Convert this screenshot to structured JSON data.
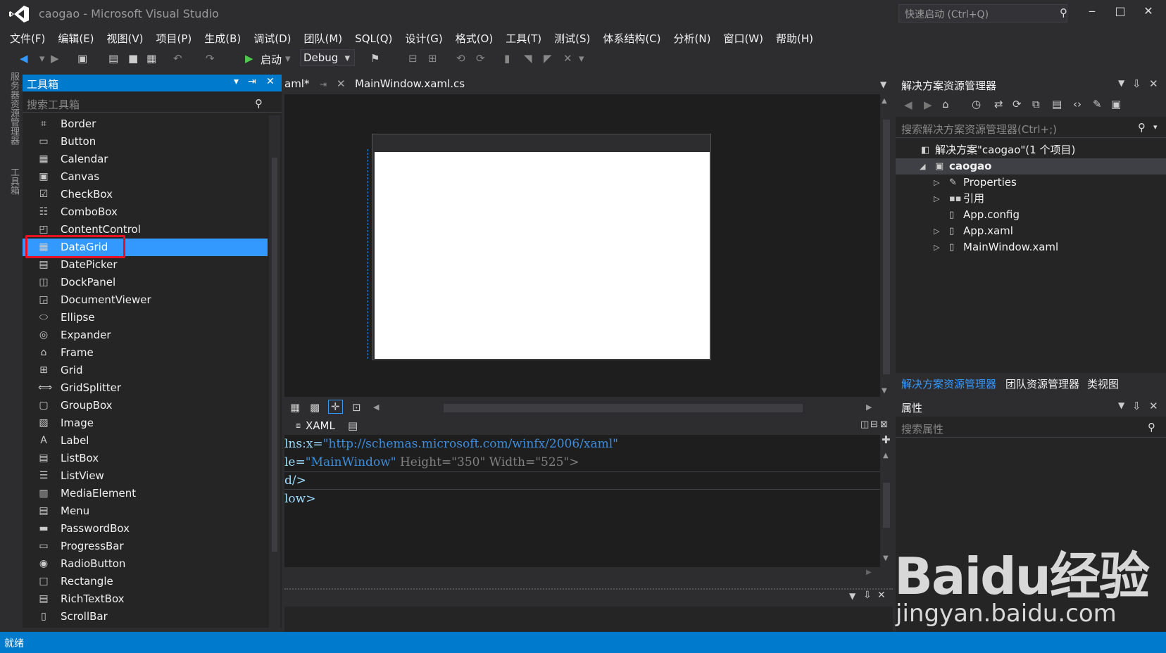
{
  "app": {
    "title": "caogao - Microsoft Visual Studio",
    "quick_launch": "快速启动 (Ctrl+Q)"
  },
  "window_controls": {
    "minimize": "‒",
    "maximize": "□",
    "close": "✕"
  },
  "menu": [
    "文件(F)",
    "编辑(E)",
    "视图(V)",
    "项目(P)",
    "生成(B)",
    "调试(D)",
    "团队(M)",
    "SQL(Q)",
    "设计(G)",
    "格式(O)",
    "工具(T)",
    "测试(S)",
    "体系结构(C)",
    "分析(N)",
    "窗口(W)",
    "帮助(H)"
  ],
  "toolbar": {
    "start_label": "启动",
    "config": "Debug"
  },
  "left_strip": {
    "server_explorer": "服务器资源管理器",
    "toolbox": "工具箱"
  },
  "toolbox": {
    "title": "工具箱",
    "search_placeholder": "搜索工具箱",
    "items": [
      {
        "label": "Border",
        "icon": "border-icon"
      },
      {
        "label": "Button",
        "icon": "button-icon"
      },
      {
        "label": "Calendar",
        "icon": "calendar-icon"
      },
      {
        "label": "Canvas",
        "icon": "canvas-icon"
      },
      {
        "label": "CheckBox",
        "icon": "checkbox-icon"
      },
      {
        "label": "ComboBox",
        "icon": "combobox-icon"
      },
      {
        "label": "ContentControl",
        "icon": "contentcontrol-icon"
      },
      {
        "label": "DataGrid",
        "icon": "datagrid-icon",
        "selected": true
      },
      {
        "label": "DatePicker",
        "icon": "datepicker-icon"
      },
      {
        "label": "DockPanel",
        "icon": "dockpanel-icon"
      },
      {
        "label": "DocumentViewer",
        "icon": "documentviewer-icon"
      },
      {
        "label": "Ellipse",
        "icon": "ellipse-icon"
      },
      {
        "label": "Expander",
        "icon": "expander-icon"
      },
      {
        "label": "Frame",
        "icon": "frame-icon"
      },
      {
        "label": "Grid",
        "icon": "grid-icon"
      },
      {
        "label": "GridSplitter",
        "icon": "gridsplitter-icon"
      },
      {
        "label": "GroupBox",
        "icon": "groupbox-icon"
      },
      {
        "label": "Image",
        "icon": "image-icon"
      },
      {
        "label": "Label",
        "icon": "label-icon"
      },
      {
        "label": "ListBox",
        "icon": "listbox-icon"
      },
      {
        "label": "ListView",
        "icon": "listview-icon"
      },
      {
        "label": "MediaElement",
        "icon": "mediaelement-icon"
      },
      {
        "label": "Menu",
        "icon": "menu-icon"
      },
      {
        "label": "PasswordBox",
        "icon": "passwordbox-icon"
      },
      {
        "label": "ProgressBar",
        "icon": "progressbar-icon"
      },
      {
        "label": "RadioButton",
        "icon": "radiobutton-icon"
      },
      {
        "label": "Rectangle",
        "icon": "rectangle-icon"
      },
      {
        "label": "RichTextBox",
        "icon": "richtextbox-icon"
      },
      {
        "label": "ScrollBar",
        "icon": "scrollbar-icon"
      }
    ]
  },
  "tabs": {
    "tab1": "aml*",
    "tab2": "MainWindow.xaml.cs"
  },
  "xaml": {
    "tab_label": "XAML",
    "lines": [
      {
        "a": "lns:x=",
        "v": "\"http://schemas.microsoft.com/winfx/2006/xaml\"",
        "b": ""
      },
      {
        "a": "le=",
        "v": "\"MainWindow\"",
        "b": " Height=\"350\" Width=\"525\">"
      },
      {
        "a": "d/>",
        "v": "",
        "b": ""
      },
      {
        "a": "low>",
        "v": "",
        "b": ""
      }
    ]
  },
  "solution_explorer": {
    "title": "解决方案资源管理器",
    "search_placeholder": "搜索解决方案资源管理器(Ctrl+;)",
    "tree": [
      {
        "label": "解决方案\"caogao\"(1 个项目)",
        "icon": "solution-icon",
        "level": 0,
        "arrow": ""
      },
      {
        "label": "caogao",
        "icon": "csharp-project-icon",
        "level": 1,
        "arrow": "◢",
        "selected": true
      },
      {
        "label": "Properties",
        "icon": "wrench-icon",
        "level": 2,
        "arrow": "▷"
      },
      {
        "label": "引用",
        "icon": "references-icon",
        "level": 2,
        "arrow": "▷"
      },
      {
        "label": "App.config",
        "icon": "config-file-icon",
        "level": 2,
        "arrow": ""
      },
      {
        "label": "App.xaml",
        "icon": "xaml-file-icon",
        "level": 2,
        "arrow": "▷"
      },
      {
        "label": "MainWindow.xaml",
        "icon": "xaml-file-icon",
        "level": 2,
        "arrow": "▷"
      }
    ],
    "bottom_tabs": [
      "解决方案资源管理器",
      "团队资源管理器",
      "类视图"
    ]
  },
  "properties": {
    "title": "属性",
    "search_placeholder": "搜索属性"
  },
  "watermark": {
    "logo": "Baidu经验",
    "url": "jingyan.baidu.com"
  },
  "status": {
    "text": "就绪"
  },
  "colors": {
    "accent": "#007acc",
    "selection": "#3399ff",
    "highlight_box": "#e81123",
    "background": "#2d2d30"
  }
}
